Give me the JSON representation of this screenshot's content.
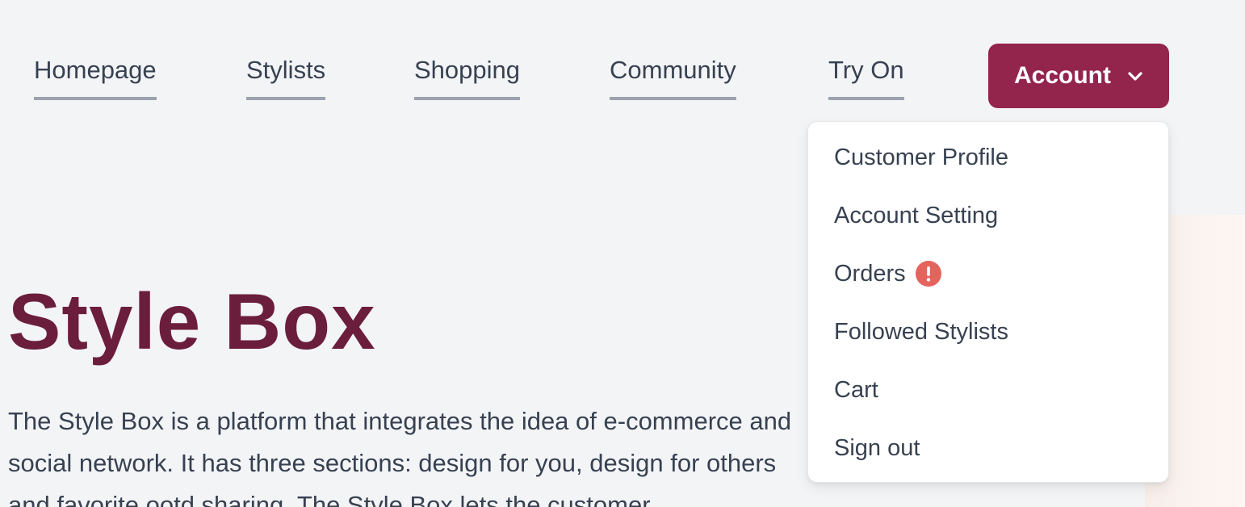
{
  "nav": {
    "links": [
      "Homepage",
      "Stylists",
      "Shopping",
      "Community",
      "Try On"
    ],
    "account_label": "Account"
  },
  "account_menu": {
    "items": [
      "Customer Profile",
      "Account Setting",
      "Orders",
      "Followed Stylists",
      "Cart",
      "Sign out"
    ],
    "orders_alert_icon": "exclamation-circle-icon",
    "alert_color": "#e5635d"
  },
  "hero": {
    "title": "Style Box",
    "description": "The Style Box is a platform that integrates the idea of e-commerce and social network. It has three sections: design for you, design for others and favorite ootd sharing. The Style Box lets the customer"
  },
  "colors": {
    "accent": "#93244c",
    "title": "#6b1e3c",
    "text": "#374151",
    "background": "#f3f4f6"
  }
}
